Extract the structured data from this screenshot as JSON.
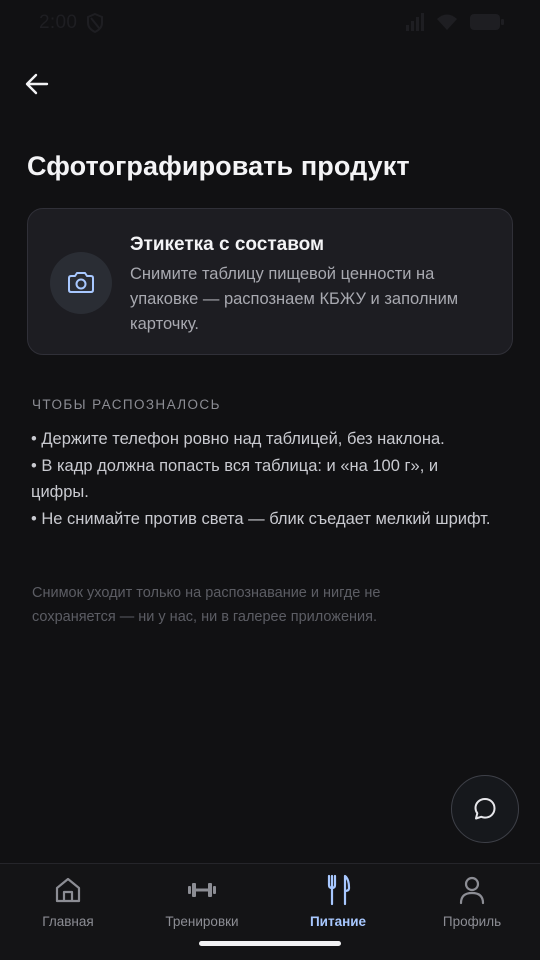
{
  "status_bar": {
    "time": "2:00"
  },
  "header": {
    "back_icon": "arrow-left-icon"
  },
  "page": {
    "title": "Сфотографировать продукт"
  },
  "card": {
    "icon": "camera-icon",
    "title": "Этикетка с составом",
    "description": "Снимите таблицу пищевой ценности на упаковке — распознаем КБЖУ и заполним карточку."
  },
  "tips": {
    "header": "ЧТОБЫ РАСПОЗНАЛОСЬ",
    "items": [
      "• Держите телефон ровно над таблицей, без наклона.",
      "• В кадр должна попасть вся таблица: и «на 100 г», и цифры.",
      "• Не снимайте против света — блик съедает мелкий шрифт."
    ]
  },
  "privacy_note": "Снимок уходит только на распознавание и нигде не сохраняется — ни у нас, ни в галерее приложения.",
  "chat_button": {
    "icon": "chat-bubble-icon"
  },
  "bottom_nav": {
    "items": [
      {
        "label": "Главная",
        "icon": "home-icon",
        "active": false
      },
      {
        "label": "Тренировки",
        "icon": "dumbbell-icon",
        "active": false
      },
      {
        "label": "Питание",
        "icon": "fork-knife-icon",
        "active": true
      },
      {
        "label": "Профиль",
        "icon": "person-icon",
        "active": false
      }
    ]
  },
  "colors": {
    "background": "#111113",
    "card": "#1d1d22",
    "accent": "#a8c8ff",
    "muted_text": "#8c8d94"
  }
}
